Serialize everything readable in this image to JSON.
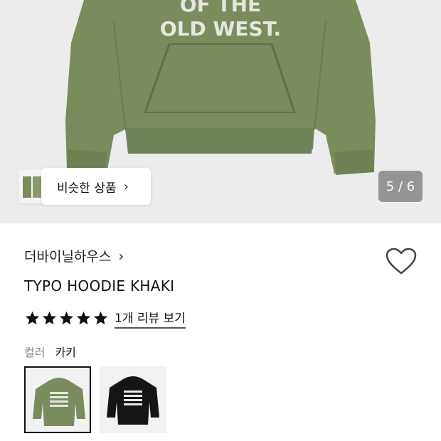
{
  "hero": {
    "print_line1": "OF THE",
    "print_line2": "OLD WEST.",
    "similar_label": "비슷한 상품",
    "counter": "5 / 6",
    "bg_color": "#ececec",
    "hoodie_color": "#7a8c5c"
  },
  "product": {
    "brand": "더바이닐하우스",
    "name": "TYPO HOODIE KHAKI",
    "rating": 5,
    "review_link": "1개 리뷰 보기",
    "color_label": "컬러",
    "color_value": "카키"
  },
  "swatches": [
    {
      "name": "khaki",
      "selected": true,
      "color": "#7a8c5c"
    },
    {
      "name": "black",
      "selected": false,
      "color": "#151515"
    }
  ]
}
